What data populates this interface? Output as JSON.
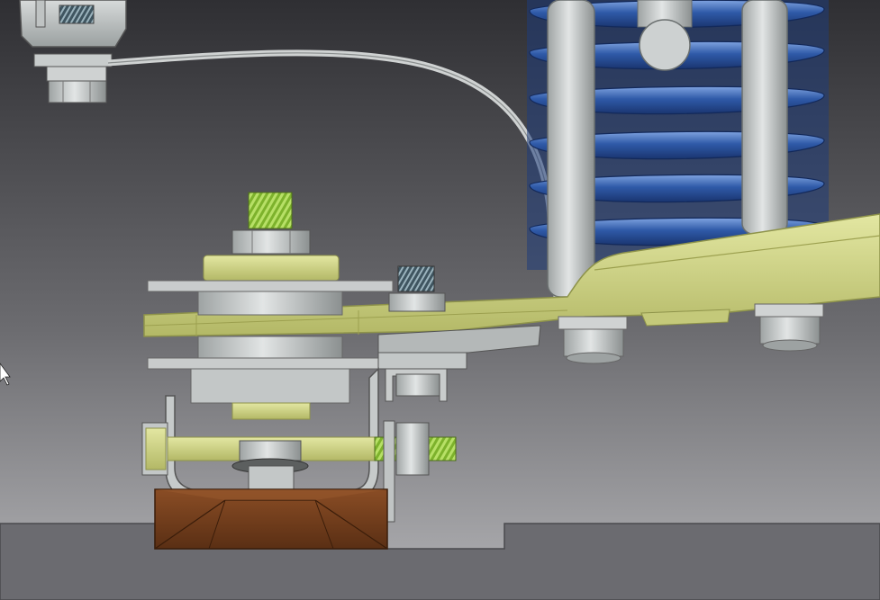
{
  "scene": {
    "description_colors": {
      "background_top": "#3a3a3d",
      "background_bottom": "#a9a9ac",
      "floor": "#6e6e72",
      "spring_blue": "#2f5aa8",
      "spring_highlight": "#7fa3e0",
      "steel": "#c2c6c6",
      "steel_dark": "#8d9292",
      "yellow_green": "#d8dc8a",
      "yellow_green_dark": "#a6ab56",
      "thread_green": "#8fc23a",
      "rubber_brown": "#6b3a1c",
      "nut_grey": "#c9cccc"
    },
    "cursor_icon": "mouse-pointer-icon"
  }
}
